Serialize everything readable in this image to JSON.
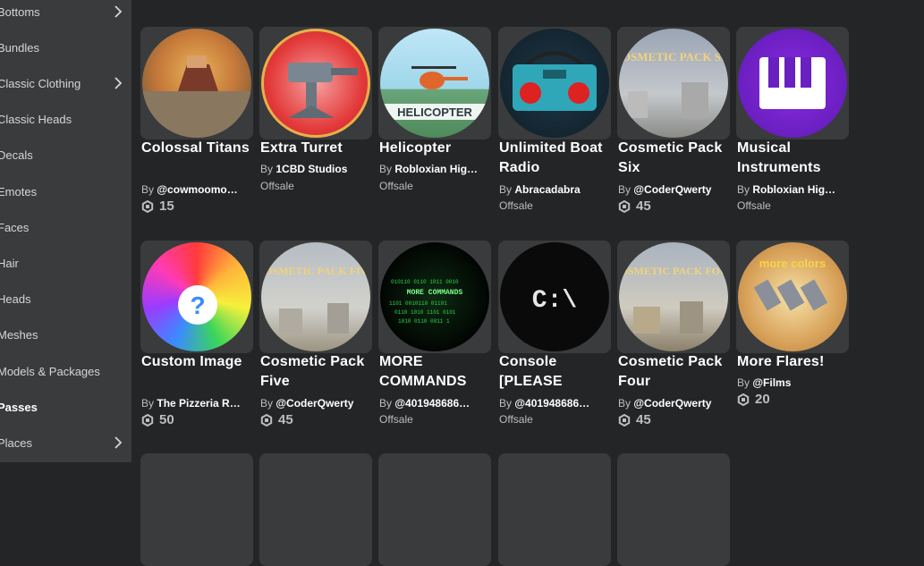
{
  "sidebar": {
    "items": [
      {
        "label": "Bottoms",
        "has_chevron": true
      },
      {
        "label": "Bundles",
        "has_chevron": false
      },
      {
        "label": "Classic Clothing",
        "has_chevron": true
      },
      {
        "label": "Classic Heads",
        "has_chevron": false
      },
      {
        "label": "Decals",
        "has_chevron": false
      },
      {
        "label": "Emotes",
        "has_chevron": false
      },
      {
        "label": "Faces",
        "has_chevron": false
      },
      {
        "label": "Hair",
        "has_chevron": false
      },
      {
        "label": "Heads",
        "has_chevron": false
      },
      {
        "label": "Meshes",
        "has_chevron": false
      },
      {
        "label": "Models & Packages",
        "has_chevron": false
      },
      {
        "label": "Passes",
        "has_chevron": false,
        "active": true
      },
      {
        "label": "Places",
        "has_chevron": true
      }
    ]
  },
  "by_prefix": "By",
  "items": [
    {
      "name": "Colossal Titans",
      "creator": "@cowmoomo…",
      "price": "15",
      "offsale": ""
    },
    {
      "name": "Extra Turret",
      "creator": "1CBD Studios",
      "price": "",
      "offsale": "Offsale"
    },
    {
      "name": "Helicopter",
      "creator": "Robloxian Hig…",
      "price": "",
      "offsale": "Offsale",
      "thumb_text": "HELICOPTER"
    },
    {
      "name": "Unlimited Boat Radio",
      "creator": "Abracadabra",
      "price": "",
      "offsale": "Offsale"
    },
    {
      "name": "Cosmetic Pack Six",
      "creator": "@CoderQwerty",
      "price": "45",
      "offsale": "",
      "thumb_text": "COSMETIC PACK SIX"
    },
    {
      "name": "Musical Instruments",
      "creator": "Robloxian Hig…",
      "price": "",
      "offsale": "Offsale"
    },
    {
      "name": "Custom Image",
      "creator": "The Pizzeria R…",
      "price": "50",
      "offsale": ""
    },
    {
      "name": "Cosmetic Pack Five",
      "creator": "@CoderQwerty",
      "price": "45",
      "offsale": "",
      "thumb_text": "COSMETIC PACK FIVE"
    },
    {
      "name": "MORE COMMANDS",
      "creator": "@401948686…",
      "price": "",
      "offsale": "Offsale",
      "thumb_text": "MORE COMMANDS"
    },
    {
      "name": "Console [PLEASE",
      "creator": "@401948686…",
      "price": "",
      "offsale": "Offsale",
      "thumb_text": "C:\\"
    },
    {
      "name": "Cosmetic Pack Four",
      "creator": "@CoderQwerty",
      "price": "45",
      "offsale": "",
      "thumb_text": "COSMETIC PACK FOUR"
    },
    {
      "name": "More Flares!",
      "creator": "@Films",
      "price": "20",
      "offsale": "",
      "thumb_text": "more colors"
    }
  ],
  "colors": {
    "background": "#232527",
    "sidebar": "#393b3d",
    "card": "#393b3d",
    "muted_text": "#bdbebe"
  }
}
